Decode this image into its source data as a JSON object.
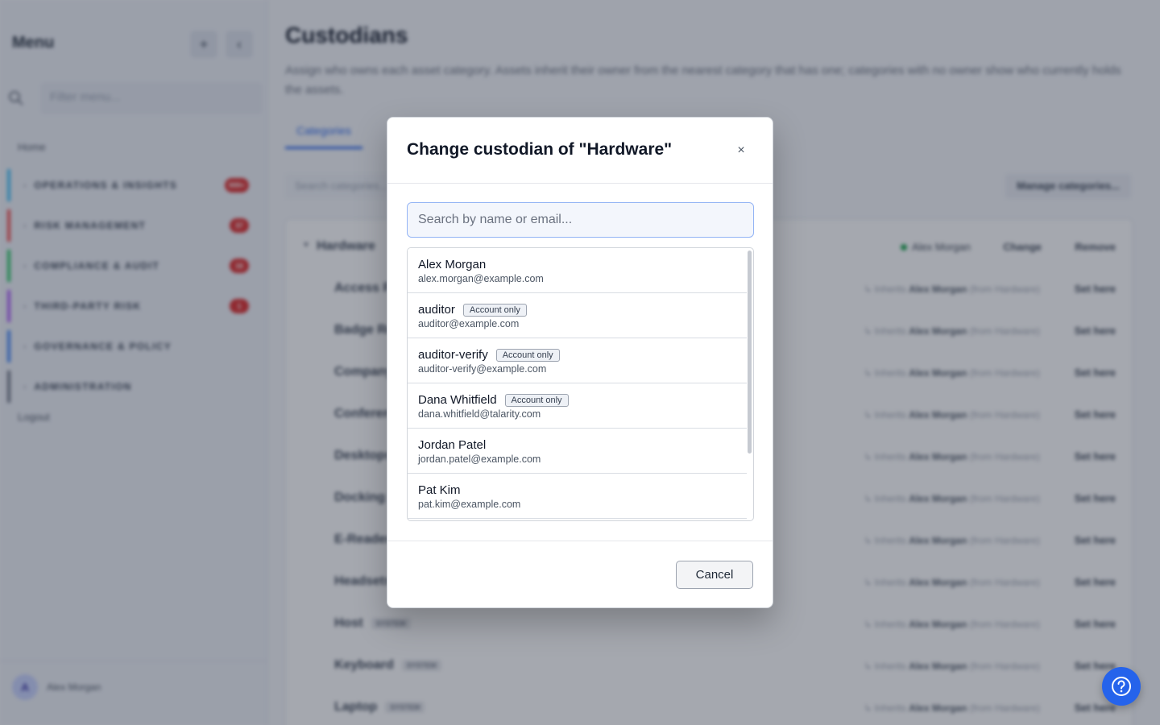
{
  "sidebar": {
    "title": "Menu",
    "add_label": "+",
    "collapse_label": "‹",
    "filter_placeholder": "Filter menu...",
    "home": "Home",
    "groups": [
      {
        "label": "OPERATIONS & INSIGHTS",
        "count": "999+",
        "color": "#38bdf8"
      },
      {
        "label": "RISK MANAGEMENT",
        "count": "37",
        "color": "#ef4444"
      },
      {
        "label": "COMPLIANCE & AUDIT",
        "count": "16",
        "color": "#22c55e"
      },
      {
        "label": "THIRD-PARTY RISK",
        "count": "1",
        "color": "#a855f7"
      },
      {
        "label": "GOVERNANCE & POLICY",
        "count": "",
        "color": "#3b82f6"
      },
      {
        "label": "ADMINISTRATION",
        "count": "",
        "color": "#6b7280"
      }
    ],
    "logout": "Logout",
    "user": {
      "initial": "A",
      "name": "Alex Morgan"
    }
  },
  "main": {
    "title": "Custodians",
    "description": "Assign who owns each asset category. Assets inherit their owner from the nearest category that has one; categories with no owner show who currently holds the assets.",
    "tab": "Categories",
    "search_placeholder": "Search categories...",
    "manage_label": "Manage categories...",
    "hardware_row": {
      "name": "Hardware",
      "owner": "Alex Morgan",
      "change": "Change",
      "remove": "Remove"
    },
    "inherit_prefix": "↳ Inherits",
    "inherit_owner": "Alex Morgan",
    "inherit_suffix": "(from Hardware)",
    "set_here": "Set here",
    "system_badge": "SYSTEM",
    "child_rows": [
      "Access Points",
      "Badge Readers",
      "Company Phones",
      "Conference Equipment",
      "Desktops",
      "Docking Stations",
      "E-Readers",
      "Headsets",
      "Host",
      "Keyboard",
      "Laptop"
    ]
  },
  "modal": {
    "title": "Change custodian of \"Hardware\"",
    "close_label": "×",
    "search_placeholder": "Search by name or email...",
    "results": [
      {
        "name": "Alex Morgan",
        "badge": "",
        "email": "alex.morgan@example.com"
      },
      {
        "name": "auditor",
        "badge": "Account only",
        "email": "auditor@example.com"
      },
      {
        "name": "auditor-verify",
        "badge": "Account only",
        "email": "auditor-verify@example.com"
      },
      {
        "name": "Dana Whitfield",
        "badge": "Account only",
        "email": "dana.whitfield@talarity.com"
      },
      {
        "name": "Jordan Patel",
        "badge": "",
        "email": "jordan.patel@example.com"
      },
      {
        "name": "Pat Kim",
        "badge": "",
        "email": "pat.kim@example.com"
      }
    ],
    "cancel_label": "Cancel"
  },
  "help": {
    "icon": "help-circle-icon"
  },
  "colors": {
    "accent": "#2563eb",
    "badge_red": "#dc2626",
    "online_green": "#16a34a"
  }
}
